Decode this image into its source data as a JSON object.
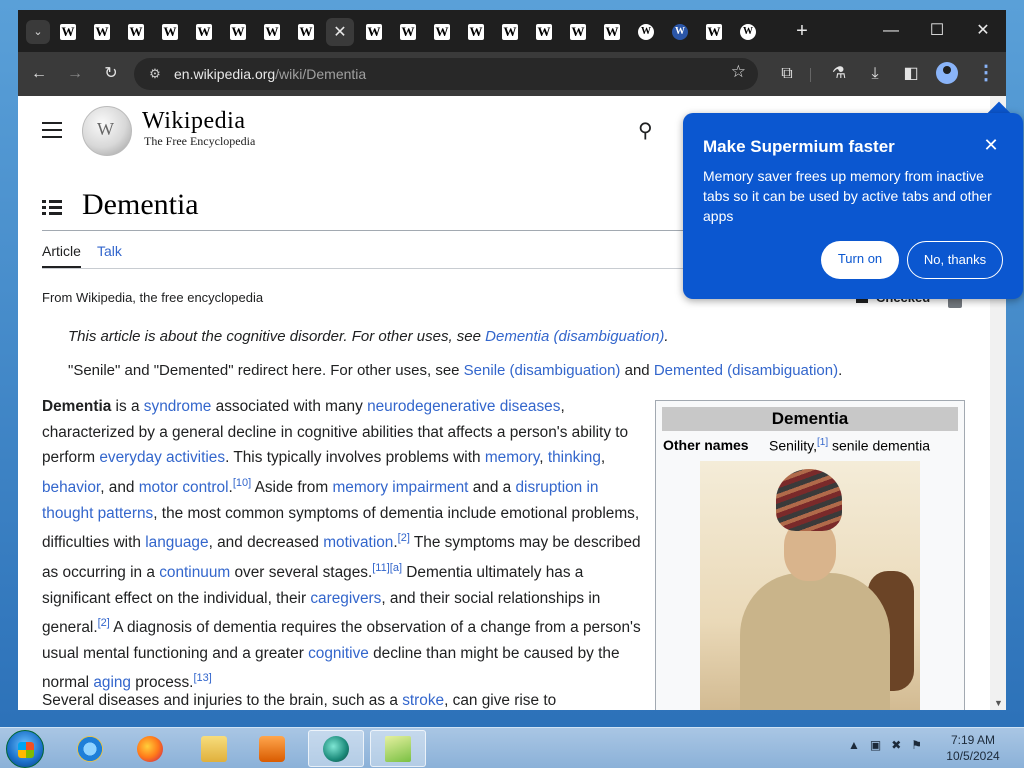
{
  "browser": {
    "tabs": [
      {
        "favicon": "W"
      },
      {
        "favicon": "W"
      },
      {
        "favicon": "W"
      },
      {
        "favicon": "W"
      },
      {
        "favicon": "W"
      },
      {
        "favicon": "W"
      },
      {
        "favicon": "W"
      },
      {
        "favicon": "W"
      },
      {
        "favicon": "W",
        "active": true
      },
      {
        "favicon": "W"
      },
      {
        "favicon": "W"
      },
      {
        "favicon": "W"
      },
      {
        "favicon": "W"
      },
      {
        "favicon": "W"
      },
      {
        "favicon": "W"
      },
      {
        "favicon": "W"
      },
      {
        "favicon": "W"
      },
      {
        "favicon": "W"
      },
      {
        "favicon": "W"
      },
      {
        "favicon": "W"
      },
      {
        "favicon": "W"
      }
    ],
    "tab_close_glyph": "✕",
    "new_tab_glyph": "+",
    "window_controls": {
      "minimize": "—",
      "maximize": "☐",
      "close": "✕"
    },
    "url": {
      "host": "en.wikipedia.org",
      "path": "/wiki/Dementia"
    }
  },
  "wikipedia": {
    "wordmark": "Wikipedia",
    "tagline": "The Free Encyclopedia",
    "title": "Dementia",
    "tabs": {
      "article": "Article",
      "talk": "Talk"
    },
    "from_line": "From Wikipedia, the free encyclopedia",
    "checked_label": "Checked",
    "hatnote1": {
      "prefix": "This article is about the cognitive disorder. For other uses, see ",
      "link": "Dementia (disambiguation)",
      "suffix": "."
    },
    "hatnote2": {
      "prefix": "\"Senile\" and \"Demented\" redirect here. For other uses, see ",
      "link1": "Senile (disambiguation)",
      "mid": " and ",
      "link2": "Demented (disambiguation)",
      "suffix": "."
    },
    "para2": {
      "prefix": "Several diseases and injuries to the brain, such as a ",
      "link": "stroke",
      "suffix": ", can give rise to"
    },
    "infobox": {
      "title": "Dementia",
      "label": "Other names",
      "value_a": "Senility,",
      "value_ref": "[1]",
      "value_b": " senile dementia"
    }
  },
  "popup": {
    "title": "Make Supermium faster",
    "body": "Memory saver frees up memory from inactive tabs so it can be used by active tabs and other apps",
    "primary": "Turn on",
    "secondary": "No, thanks",
    "close": "✕",
    "accent": "#0b57d0"
  },
  "taskbar": {
    "apps": [
      "internet-explorer",
      "firefox",
      "file-explorer",
      "media-player",
      "browser-app",
      "editor-app"
    ],
    "time": "7:19 AM",
    "date": "10/5/2024"
  }
}
